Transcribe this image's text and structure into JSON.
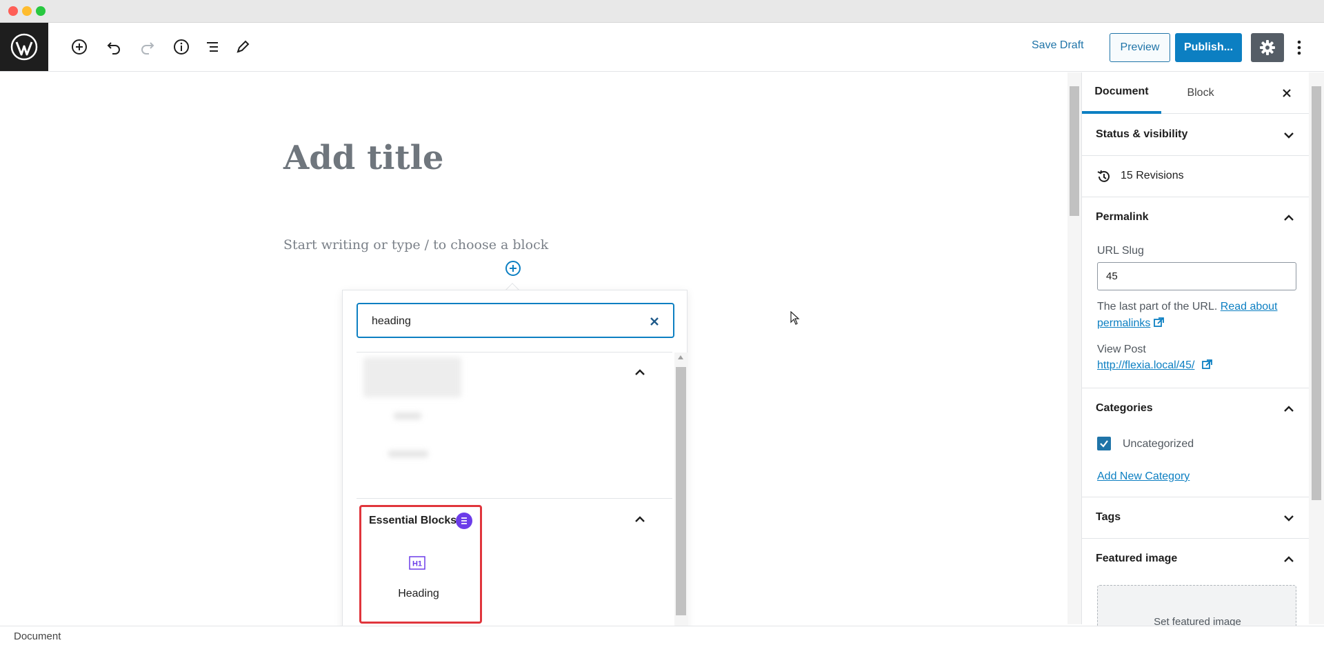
{
  "toolbar": {
    "save_draft": "Save Draft",
    "preview": "Preview",
    "publish": "Publish..."
  },
  "editor": {
    "title_placeholder": "Add title",
    "paragraph_placeholder": "Start writing or type / to choose a block"
  },
  "inserter": {
    "search_value": "heading",
    "category": {
      "title": "Essential Blocks",
      "badge_color": "#6c3ce9",
      "blocks": [
        {
          "label": "Heading",
          "icon": "h1-icon"
        }
      ]
    }
  },
  "sidebar": {
    "tabs": [
      "Document",
      "Block"
    ],
    "panels": {
      "status_visibility": "Status & visibility",
      "revisions": "15 Revisions",
      "permalink": {
        "title": "Permalink",
        "url_slug_label": "URL Slug",
        "url_slug_value": "45",
        "help_text": "The last part of the URL.",
        "help_link": "Read about",
        "help_link_2": "permalinks",
        "view_post_label": "View Post",
        "view_post_link": "http://flexia.local/45/"
      },
      "categories": {
        "title": "Categories",
        "items": [
          {
            "label": "Uncategorized",
            "checked": true
          }
        ],
        "add_new": "Add New Category"
      },
      "tags": "Tags",
      "featured_image": {
        "title": "Featured image",
        "set_label": "Set featured image"
      }
    }
  },
  "footer": {
    "breadcrumb": "Document"
  },
  "colors": {
    "accent": "#0c7fc2",
    "highlight": "#e0353c"
  }
}
